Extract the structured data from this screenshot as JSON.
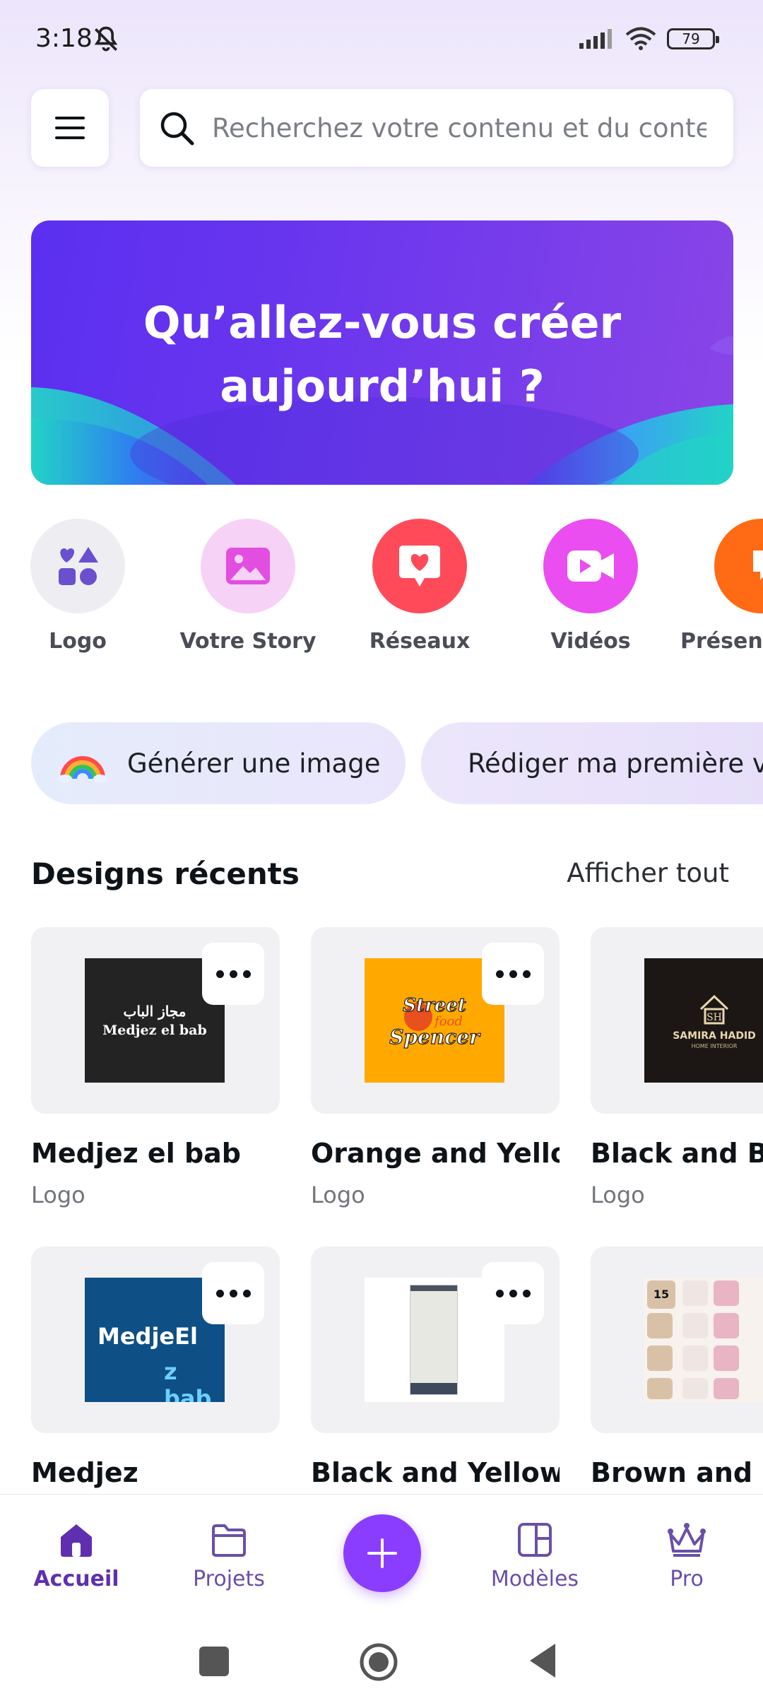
{
  "status_bar": {
    "time": "3:18",
    "battery": "79"
  },
  "header": {
    "search_placeholder": "Recherchez votre contenu et du contenu Canva"
  },
  "hero": {
    "title_line1": "Qu’allez-vous créer",
    "title_line2": "aujourd’hui ?"
  },
  "categories": [
    {
      "label": "Logo",
      "icon": "shapes-icon",
      "bg": "#eeeef2",
      "fg": "#6a4fcf"
    },
    {
      "label": "Votre Story",
      "icon": "image-icon",
      "bg": "#f6d2f6",
      "fg": "#e24ee0"
    },
    {
      "label": "Réseaux",
      "icon": "heart-chat-icon",
      "bg": "#ff4a5a",
      "fg": "#ffffff"
    },
    {
      "label": "Vidéos",
      "icon": "video-camera-icon",
      "bg": "#ea4df0",
      "fg": "#ffffff"
    },
    {
      "label": "Présentations",
      "icon": "presentation-icon",
      "bg": "#ff6a14",
      "fg": "#ffffff"
    }
  ],
  "ai_actions": [
    {
      "label": "Générer une image",
      "icon": "rainbow-icon"
    },
    {
      "label": "Rédiger ma première version",
      "icon": "magic-pen-icon"
    }
  ],
  "recent": {
    "title": "Designs récents",
    "see_all": "Afficher tout",
    "items": [
      {
        "title": "Medjez el bab",
        "type": "Logo",
        "art_text_ar": "مجاز الباب",
        "art_text": "Medjez el bab"
      },
      {
        "title": "Orange and Yello...",
        "type": "Logo",
        "art_text": "Street food Spencer"
      },
      {
        "title": "Black and Brown...",
        "type": "Logo",
        "art_text": "SAMIRA HADID",
        "art_sub": "HOME INTERIOR"
      },
      {
        "title": "Medjez",
        "type": "",
        "art_text": "MedjeEl",
        "art_text2": "z bab"
      },
      {
        "title": "Black and Yellow ...",
        "type": ""
      },
      {
        "title": "Brown and Pink...",
        "type": "",
        "art_num": "15"
      }
    ]
  },
  "bottom_nav": [
    {
      "label": "Accueil",
      "icon": "home-icon",
      "active": true
    },
    {
      "label": "Projets",
      "icon": "folder-icon",
      "active": false
    },
    {
      "label": "Modèles",
      "icon": "templates-icon",
      "active": false
    },
    {
      "label": "Pro",
      "icon": "crown-icon",
      "active": false
    }
  ],
  "colors": {
    "accent": "#8b3dff",
    "nav_text": "#6a4fa8"
  }
}
